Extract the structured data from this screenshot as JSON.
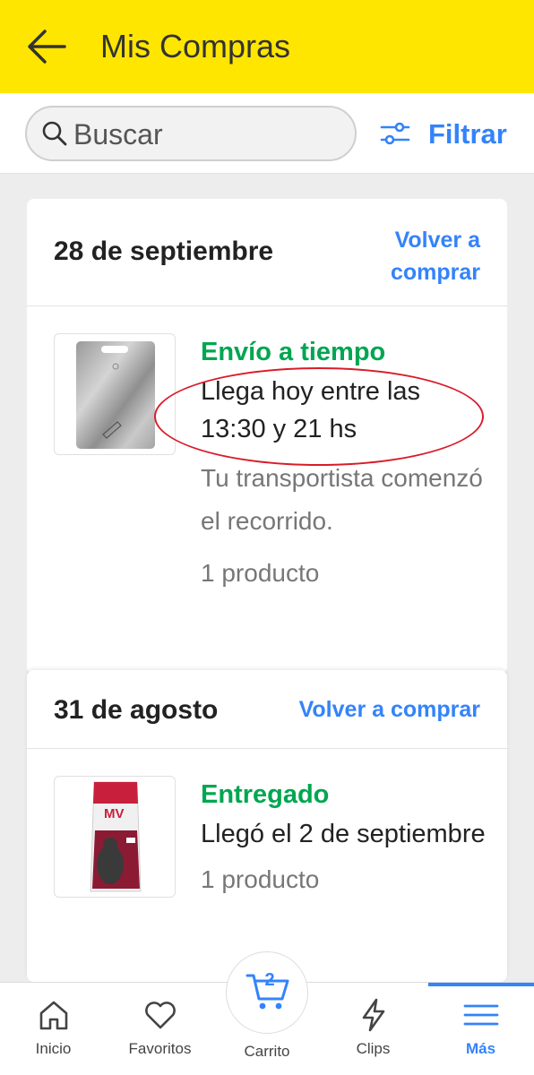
{
  "header": {
    "title": "Mis Compras",
    "bg_color": "#ffe600",
    "back_icon": "arrow-left-icon"
  },
  "search": {
    "placeholder": "Buscar",
    "filter_label": "Filtrar",
    "accent_color": "#3483fa"
  },
  "purchases": [
    {
      "date": "28 de septiembre",
      "rebuy_label": "Volver a comprar",
      "product_image": "metal-cutting-board",
      "status": "Envío a tiempo",
      "detail": "Llega hoy entre las 13:30 y 21 hs",
      "note": "Tu transportista comenzó el recorrido.",
      "count": "1 producto"
    },
    {
      "date": "31 de agosto",
      "rebuy_label": "Volver a comprar",
      "product_image": "cat-food-bag",
      "status": "Entregado",
      "detail": "Llegó el 2 de septiembre",
      "count": "1 producto"
    }
  ],
  "bottom_nav": {
    "items": [
      {
        "label": "Inicio",
        "icon": "home-icon"
      },
      {
        "label": "Favoritos",
        "icon": "heart-icon"
      },
      {
        "label": "Carrito",
        "icon": "cart-icon",
        "badge": "2"
      },
      {
        "label": "Clips",
        "icon": "lightning-icon"
      },
      {
        "label": "Más",
        "icon": "menu-icon",
        "active": true
      }
    ]
  },
  "colors": {
    "status_green": "#00a650",
    "link_blue": "#3483fa",
    "annotation_red": "#d81c2a"
  }
}
